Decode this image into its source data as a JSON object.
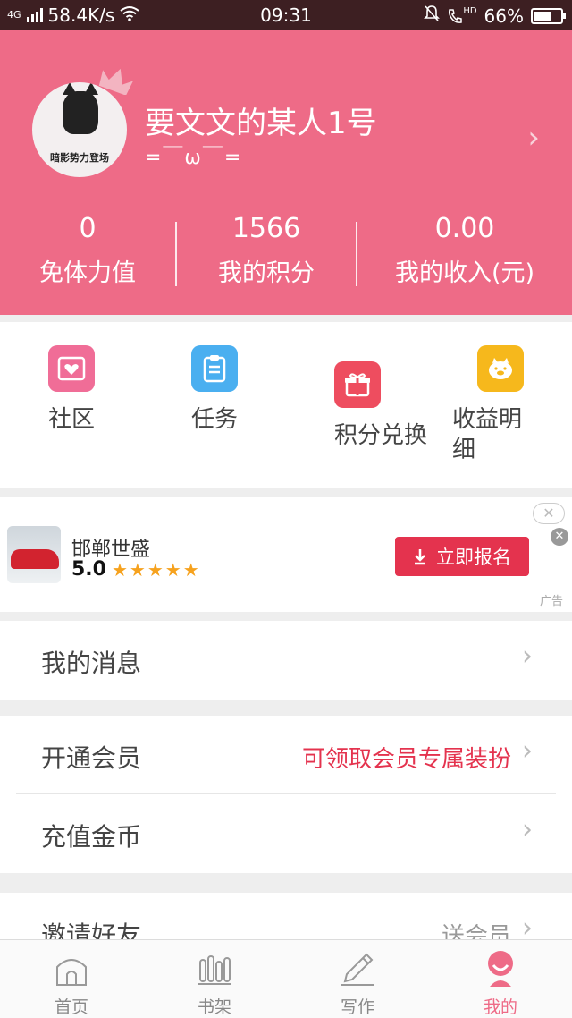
{
  "status_bar": {
    "network": "4G",
    "speed": "58.4K/s",
    "time": "09:31",
    "hd": "HD",
    "battery": "66%",
    "battery_level": 0.66
  },
  "profile": {
    "avatar_caption": "暗影势力登场",
    "username": "要文文的某人1号",
    "signature": "=￣ω￣="
  },
  "stats": [
    {
      "value": "0",
      "label": "免体力值"
    },
    {
      "value": "1566",
      "label": "我的积分"
    },
    {
      "value": "0.00",
      "label": "我的收入(元)"
    }
  ],
  "shortcuts": [
    {
      "label": "社区",
      "icon": "heart-mail-icon",
      "color": "#f06d97"
    },
    {
      "label": "任务",
      "icon": "clipboard-icon",
      "color": "#4aaff0"
    },
    {
      "label": "积分兑换",
      "icon": "gift-icon",
      "color": "#ee4d5f"
    },
    {
      "label": "收益明细",
      "icon": "piggy-bank-icon",
      "color": "#f6b81c"
    }
  ],
  "ad": {
    "title": "邯郸世盛",
    "rating": "5.0",
    "stars": "★★★★★",
    "button_label": "立即报名",
    "close_pill": "✕",
    "close_dot": "✕",
    "tag": "广告"
  },
  "menu": {
    "messages": "我的消息",
    "vip": "开通会员",
    "vip_extra": "可领取会员专属装扮",
    "recharge": "充值金币",
    "invite": "邀请好友",
    "invite_extra": "送会员"
  },
  "nav": [
    {
      "label": "首页",
      "icon": "home-icon"
    },
    {
      "label": "书架",
      "icon": "bookshelf-icon"
    },
    {
      "label": "写作",
      "icon": "pen-icon"
    },
    {
      "label": "我的",
      "icon": "profile-icon",
      "active": true
    }
  ],
  "colors": {
    "accent": "#ee6b87",
    "status_bar": "#3d1f22",
    "highlight_text": "#e4334e",
    "ad_button": "#e4334e"
  }
}
